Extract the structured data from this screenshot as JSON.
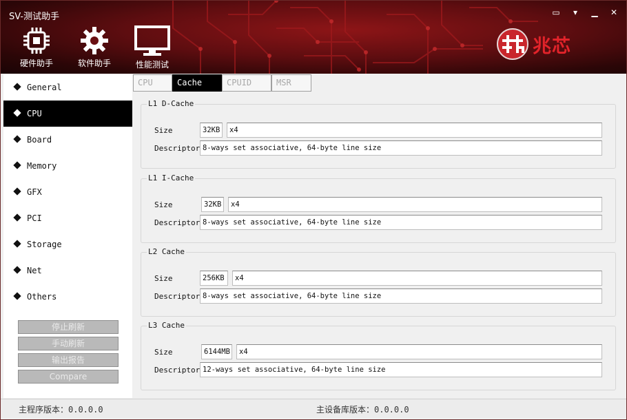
{
  "window": {
    "title": "SV-测试助手"
  },
  "window_controls": {
    "feedback": "▭",
    "menu": "▾",
    "minimize": "▁",
    "close": "✕"
  },
  "toolbar": [
    {
      "label": "硬件助手",
      "icon": "chip-icon"
    },
    {
      "label": "软件助手",
      "icon": "gear-icon"
    },
    {
      "label": "性能测试",
      "icon": "monitor-icon"
    }
  ],
  "brand": {
    "name": "兆芯",
    "color": "#e2232a"
  },
  "sidebar": {
    "items": [
      {
        "label": "General"
      },
      {
        "label": "CPU"
      },
      {
        "label": "Board"
      },
      {
        "label": "Memory"
      },
      {
        "label": "GFX"
      },
      {
        "label": "PCI"
      },
      {
        "label": "Storage"
      },
      {
        "label": "Net"
      },
      {
        "label": "Others"
      }
    ],
    "active": "CPU",
    "actions": {
      "stop_refresh": "停止刷新",
      "manual_refresh": "手动刷新",
      "export_report": "输出报告",
      "compare": "Compare"
    }
  },
  "tabs": [
    {
      "label": "CPU"
    },
    {
      "label": "Cache"
    },
    {
      "label": "CPUID"
    },
    {
      "label": "MSR"
    }
  ],
  "active_tab": "Cache",
  "cache": {
    "size_label": "Size",
    "descriptor_label": "Descriptor",
    "groups": [
      {
        "title": "L1 D-Cache",
        "size": "32KB",
        "count": "x4",
        "descriptor": "8-ways set associative, 64-byte line size"
      },
      {
        "title": "L1 I-Cache",
        "size": "32KB",
        "count": "x4",
        "descriptor": "8-ways set associative, 64-byte line size"
      },
      {
        "title": "L2 Cache",
        "size": "256KB",
        "count": "x4",
        "descriptor": "8-ways set associative, 64-byte line size"
      },
      {
        "title": "L3 Cache",
        "size": "6144MB",
        "count": "x4",
        "descriptor": "12-ways set associative, 64-byte line size"
      }
    ]
  },
  "status": {
    "main_version": "主程序版本：0.0.0.0",
    "db_version": "主设备库版本：0.0.0.0"
  }
}
